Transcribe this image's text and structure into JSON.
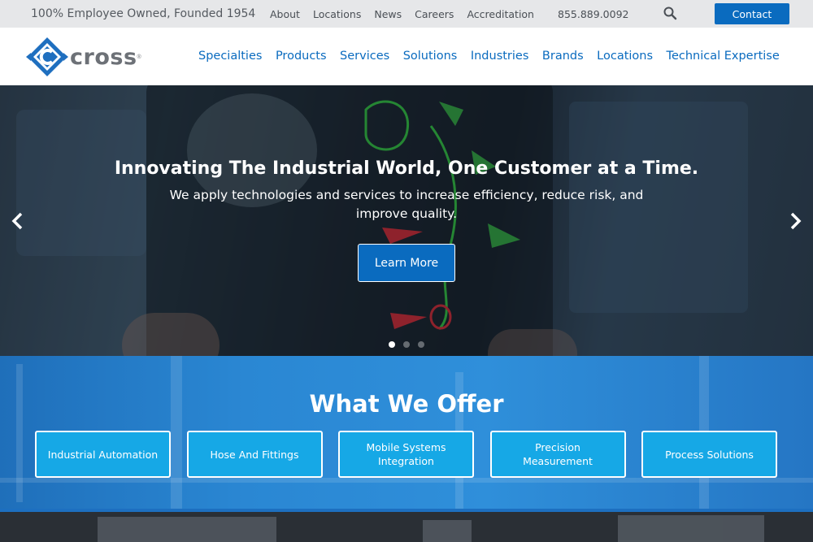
{
  "topbar": {
    "tagline": "100% Employee Owned, Founded 1954",
    "links": [
      "About",
      "Locations",
      "News",
      "Careers",
      "Accreditation"
    ],
    "phone": "855.889.0092",
    "contact_label": "Contact"
  },
  "header": {
    "logo_text": "cross",
    "logo_reg": "®",
    "nav": [
      "Specialties",
      "Products",
      "Services",
      "Solutions",
      "Industries",
      "Brands",
      "Locations",
      "Technical Expertise"
    ]
  },
  "hero": {
    "title": "Innovating The Industrial World, One Customer at a Time.",
    "subtitle": "We apply technologies and services to increase efficiency, reduce risk, and improve quality.",
    "button_label": "Learn More",
    "slide_count": 3,
    "active_slide": 1
  },
  "offer": {
    "title": "What We Offer",
    "cards": [
      "Industrial Automation",
      "Hose And Fittings",
      "Mobile Systems Integration",
      "Precision Measurement",
      "Process Solutions"
    ]
  },
  "colors": {
    "brand_blue": "#0a6bbf",
    "card_blue": "#16a8e6",
    "topbar_gray": "#e6e7e9"
  },
  "icons": {
    "search": "search-icon",
    "prev": "chevron-left-icon",
    "next": "chevron-right-icon"
  }
}
